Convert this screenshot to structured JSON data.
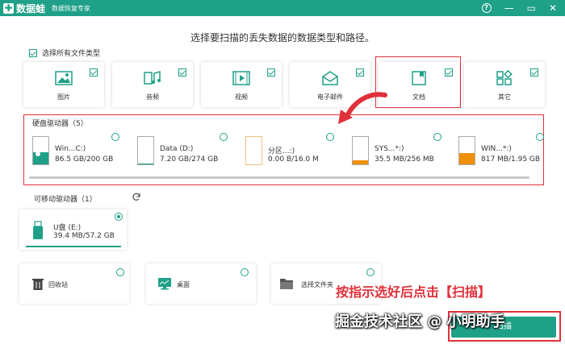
{
  "app": {
    "logo_mark": "✚",
    "name": "数据蛙",
    "subtitle": "数据恢复专家",
    "brand_color": "#1fa088",
    "highlight_color": "#e0303a",
    "icons": [
      "help-icon",
      "minimize-icon",
      "restore-icon",
      "close-icon"
    ],
    "win_minimize": "—",
    "win_restore": "▭",
    "win_close": "✕"
  },
  "page_subtitle": "选择要扫描的丢失数据的数据类型和路径。",
  "select_all_label": "选择所有文件类型",
  "file_types": [
    {
      "label": "图片",
      "icon": "image-icon",
      "checked": true
    },
    {
      "label": "音频",
      "icon": "audio-icon",
      "checked": true
    },
    {
      "label": "视频",
      "icon": "video-icon",
      "checked": true
    },
    {
      "label": "电子邮件",
      "icon": "email-icon",
      "checked": true
    },
    {
      "label": "文档",
      "icon": "document-icon",
      "checked": true
    },
    {
      "label": "其它",
      "icon": "other-icon",
      "checked": true
    }
  ],
  "hard_drives": {
    "title": "硬盘驱动器（5）",
    "items": [
      {
        "name": "Win...C:)",
        "size": "86.5 GB/200 GB",
        "fill_percent": 43,
        "fill_color": "#1fa088",
        "selected": false
      },
      {
        "name": "Data (D:)",
        "size": "7.20 GB/274 GB",
        "fill_percent": 3,
        "fill_color": "#1fa088",
        "selected": false
      },
      {
        "name": "分区...:)",
        "size": "0.00  B/16.0 M",
        "fill_percent": 0,
        "fill_color": "#f0a030",
        "selected": false
      },
      {
        "name": "SYS...*:)",
        "size": "35.5 MB/256 MB",
        "fill_percent": 14,
        "fill_color": "#f0900a",
        "selected": false
      },
      {
        "name": "WIN...*:)",
        "size": "817 MB/1.95 GB",
        "fill_percent": 42,
        "fill_color": "#f0900a",
        "selected": false
      }
    ]
  },
  "removable": {
    "title": "可移动驱动器（1）",
    "refresh_icon": "refresh-icon",
    "items": [
      {
        "name": "U盘 (E:)",
        "size": "39.4 MB/57.2 GB",
        "selected": true
      }
    ]
  },
  "locations": [
    {
      "label": "回收站",
      "icon": "recycle-bin-icon"
    },
    {
      "label": "桌面",
      "icon": "desktop-icon"
    },
    {
      "label": "选择文件夹",
      "icon": "folder-icon"
    }
  ],
  "overlay_instruction": "按指示选好后点击【扫描】",
  "watermark": "掘金技术社区 @ 小明助手",
  "start_button_label": "扫描"
}
